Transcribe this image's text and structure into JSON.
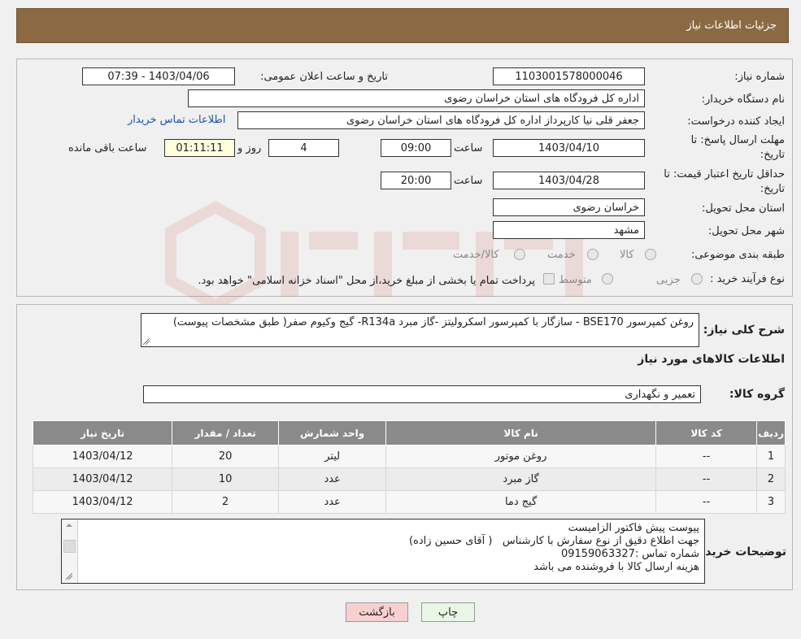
{
  "header": {
    "title": "جزئیات اطلاعات نیاز"
  },
  "info": {
    "need_number_label": "شماره نیاز:",
    "need_number": "1103001578000046",
    "announce_label": "تاریخ و ساعت اعلان عمومی:",
    "announce_value": "1403/04/06 - 07:39",
    "buyer_org_label": "نام دستگاه خریدار:",
    "buyer_org": "اداره کل فرودگاه های استان خراسان رضوی",
    "creator_label": "ایجاد کننده درخواست:",
    "creator": "جعفر قلی نیا کارپرداز اداره کل فرودگاه های استان خراسان رضوی",
    "contact_link": "اطلاعات تماس خریدار",
    "deadline_label_1": "مهلت ارسال پاسخ: تا",
    "deadline_label_2": "تاریخ:",
    "deadline_date": "1403/04/10",
    "time_label": "ساعت",
    "deadline_time": "09:00",
    "days_value": "4",
    "days_label": "روز و",
    "remaining_value": "01:11:11",
    "remaining_label": "ساعت باقی مانده",
    "validity_label_1": "حداقل تاریخ اعتبار قیمت: تا",
    "validity_label_2": "تاریخ:",
    "validity_date": "1403/04/28",
    "validity_time": "20:00",
    "province_label": "استان محل تحویل:",
    "province": "خراسان رضوی",
    "city_label": "شهر محل تحویل:",
    "city": "مشهد",
    "category_label": "طبقه بندی موضوعی:",
    "category_options": [
      "کالا",
      "خدمت",
      "کالا/خدمت"
    ],
    "process_label": "نوع فرآیند خرید :",
    "process_options": [
      "جزیی",
      "متوسط"
    ],
    "process_note": "پرداخت تمام یا بخشی از مبلغ خرید،از محل \"اسناد خزانه اسلامی\" خواهد بود."
  },
  "summary": {
    "label": "شرح کلی نیاز:",
    "text": "روغن کمپرسور BSE170 -  سازگار با کمپرسور اسکرولیتز -گاز مبرد R134a- گیج وکیوم صفر( طبق مشخصات پیوست)"
  },
  "goods": {
    "section_title": "اطلاعات کالاهای مورد نیاز",
    "group_label": "گروه کالا:",
    "group_value": "تعمیر و نگهداری"
  },
  "table": {
    "headers": [
      "ردیف",
      "کد کالا",
      "نام کالا",
      "واحد شمارش",
      "تعداد / مقدار",
      "تاریخ نیاز"
    ],
    "rows": [
      [
        "1",
        "--",
        "روغن موتور",
        "لیتر",
        "20",
        "1403/04/12"
      ],
      [
        "2",
        "--",
        "گاز مبرد",
        "عدد",
        "10",
        "1403/04/12"
      ],
      [
        "3",
        "--",
        "گیج دما",
        "عدد",
        "2",
        "1403/04/12"
      ]
    ]
  },
  "buyer_notes": {
    "label": "توضیحات خریدار:",
    "lines": [
      "پیوست پیش فاکتور الزامیست",
      "جهت اطلاع دقیق از نوع سفارش با کارشناس   ( آقای حسین زاده)",
      "شماره تماس :09159063327",
      "هزینه ارسال کالا با فروشنده می باشد"
    ]
  },
  "buttons": {
    "print": "چاپ",
    "back": "بازگشت"
  },
  "colors": {
    "header": "#8b6a43",
    "table_header": "#8a8a8a",
    "link": "#1a55b5",
    "back_button": "#f8d0d0"
  }
}
